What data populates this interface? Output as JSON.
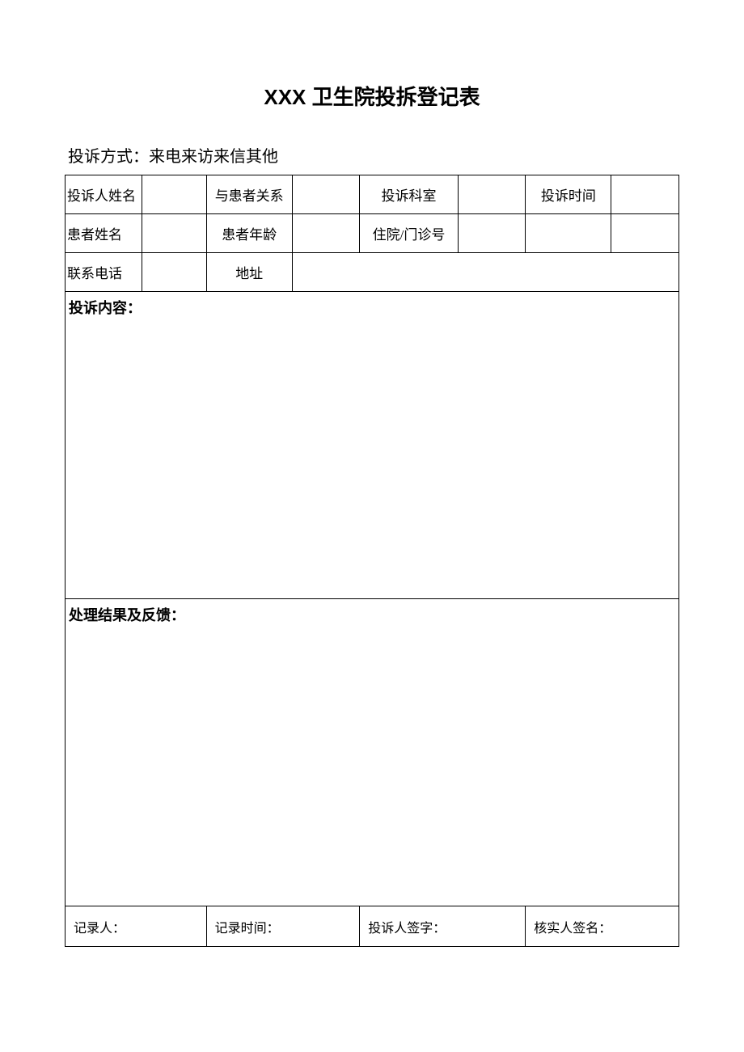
{
  "title": "XXX 卫生院投拆登记表",
  "method_line": "投诉方式：来电来访来信其他",
  "labels": {
    "complainant_name": "投诉人姓名",
    "relation": "与患者关系",
    "department": "投诉科室",
    "complaint_time": "投诉时间",
    "patient_name": "患者姓名",
    "patient_age": "患者年龄",
    "inpatient_no": "住院/门诊号",
    "phone": "联系电话",
    "address": "地址",
    "content": "投诉内容：",
    "result": "处理结果及反馈：",
    "recorder": "记录人：",
    "record_time": "记录时间：",
    "complainant_sign": "投诉人签字：",
    "verifier_sign": "核实人签名："
  },
  "values": {
    "complainant_name": "",
    "relation": "",
    "department": "",
    "complaint_time": "",
    "patient_name": "",
    "patient_age": "",
    "inpatient_no": "",
    "inpatient_extra1": "",
    "inpatient_extra2": "",
    "phone": "",
    "address": "",
    "content_body": "",
    "result_body": "",
    "recorder": "",
    "record_time": "",
    "complainant_sign": "",
    "verifier_sign": ""
  }
}
